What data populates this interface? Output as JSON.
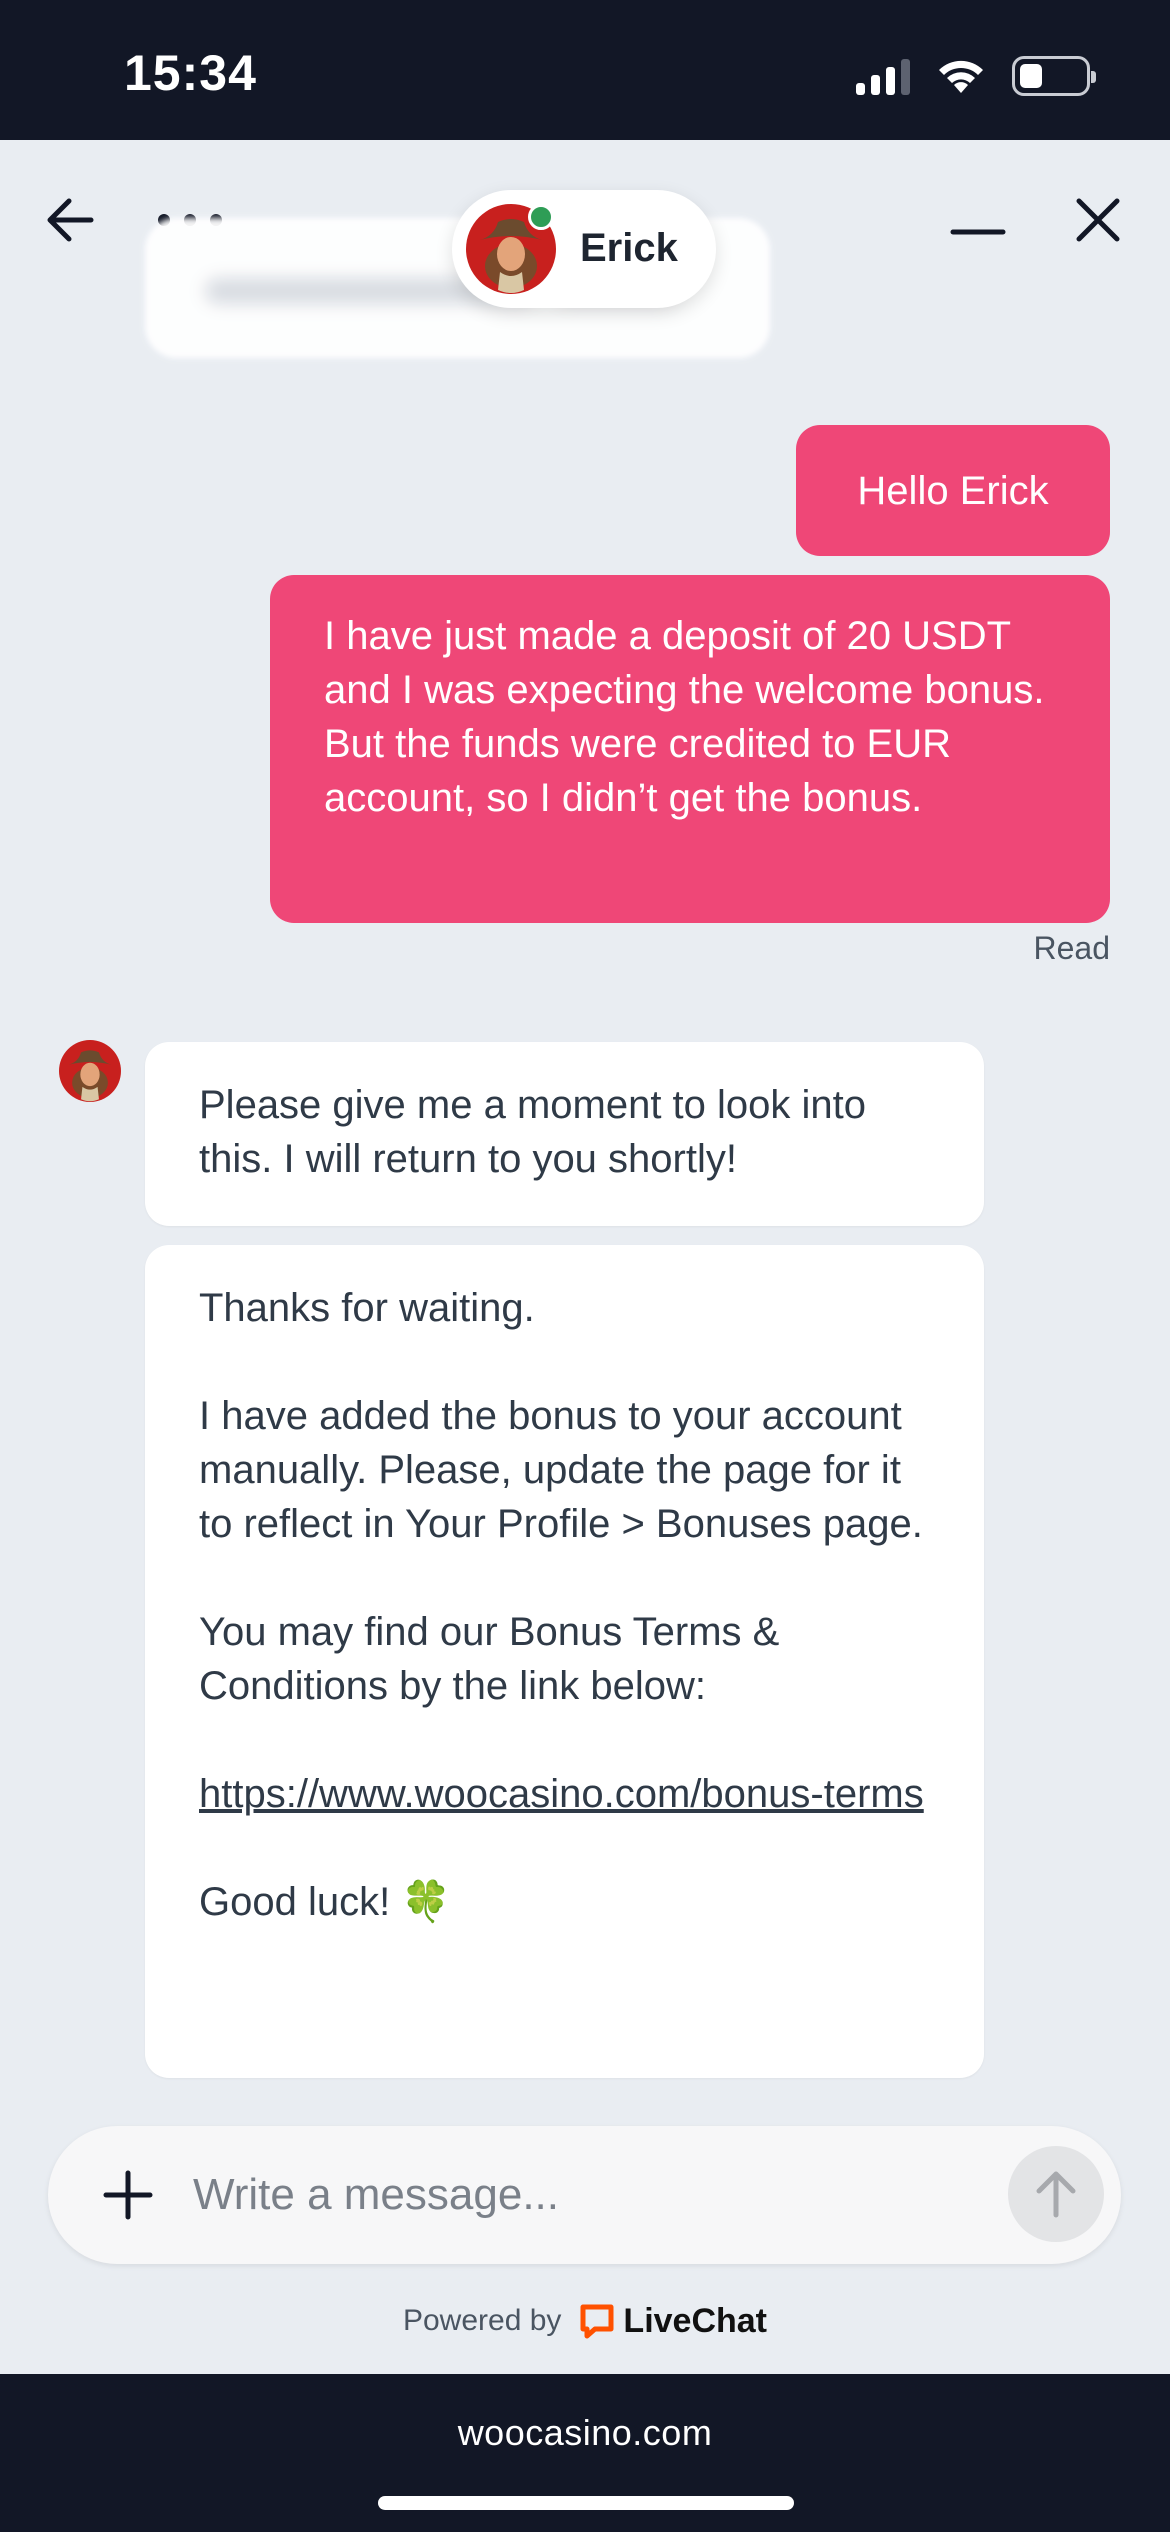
{
  "status_bar": {
    "time": "15:34"
  },
  "header": {
    "agent_name": "Erick"
  },
  "messages": {
    "out1": "Hello Erick",
    "out2": "I have just made a deposit of 20 USDT and I was expecting the welcome bonus. But the funds were credited to EUR account, so I didn’t get the bonus.",
    "read": "Read",
    "in1": "Please give me a moment to look into this. I will return to you shortly!",
    "in2": {
      "p1": "Thanks for waiting.",
      "p2": "I have added the bonus to your account manually. Please, update the page for it to reflect in Your Profile > Bonuses page.",
      "p3": "You may find our Bonus Terms & Conditions by the link below:",
      "link": "https://www.woocasino.com/bonus-terms",
      "p4": "Good luck! 🍀"
    }
  },
  "composer": {
    "placeholder": "Write a message..."
  },
  "footer": {
    "powered_by": "Powered by",
    "brand": "LiveChat"
  },
  "browser": {
    "domain": "woocasino.com"
  },
  "colors": {
    "accent": "#ef4777",
    "online": "#2e9d56",
    "livechat": "#ff5100",
    "dark": "#121726"
  },
  "icons": [
    "back-arrow-icon",
    "more-dots-icon",
    "minimize-icon",
    "close-icon",
    "plus-icon",
    "send-arrow-icon",
    "livechat-logo-icon",
    "signal-icon",
    "wifi-icon",
    "battery-icon"
  ]
}
